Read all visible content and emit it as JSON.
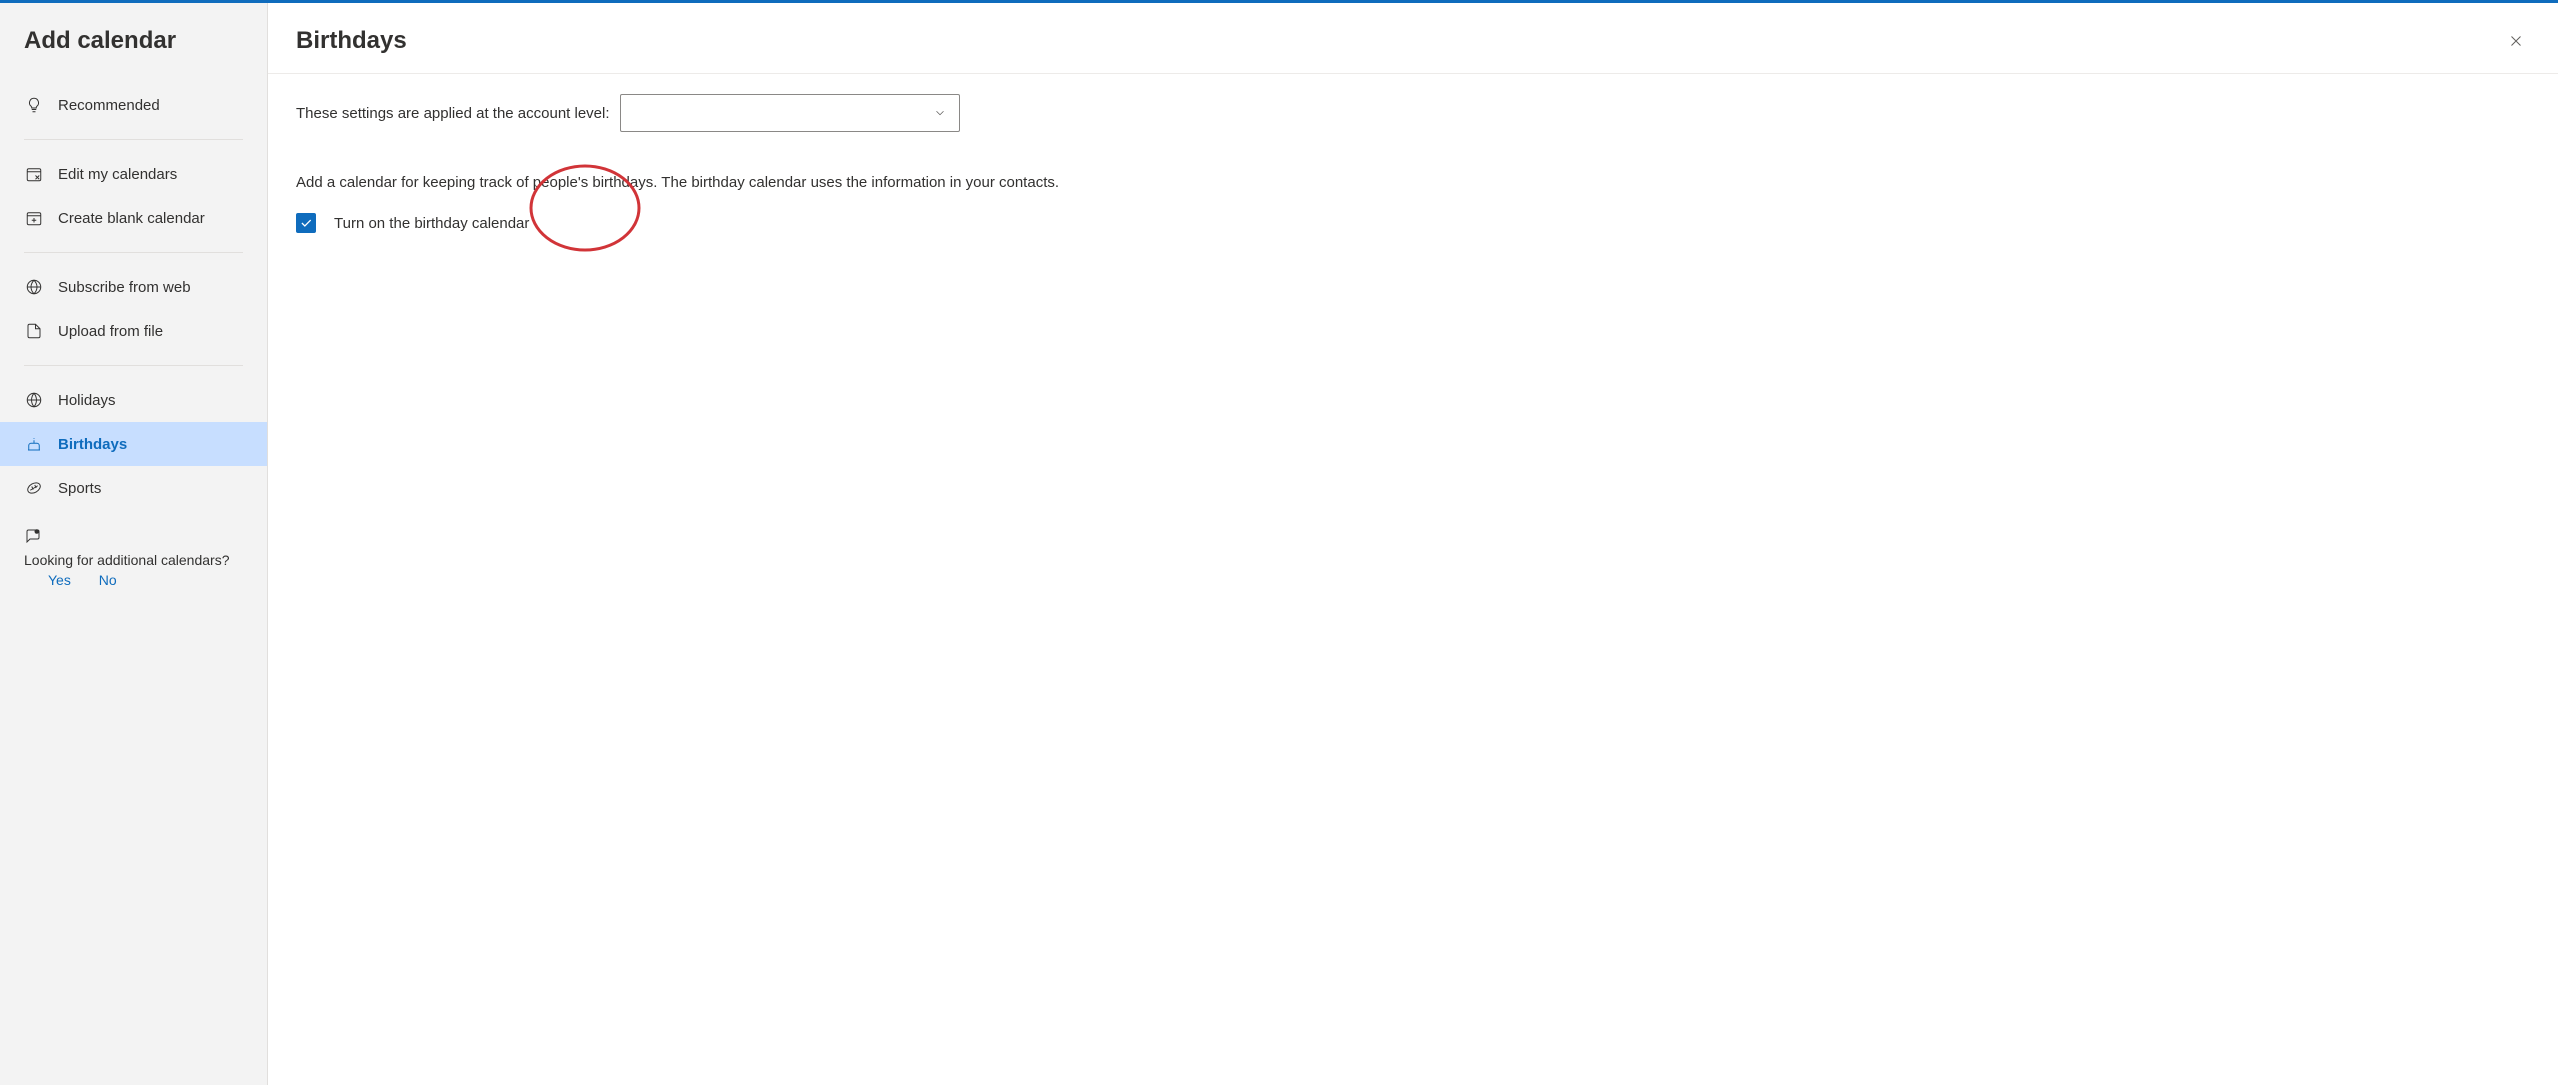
{
  "sidebar": {
    "title": "Add calendar",
    "items": {
      "recommended": "Recommended",
      "editMyCalendars": "Edit my calendars",
      "createBlank": "Create blank calendar",
      "subscribeFromWeb": "Subscribe from web",
      "uploadFromFile": "Upload from file",
      "holidays": "Holidays",
      "birthdays": "Birthdays",
      "sports": "Sports"
    },
    "feedback": {
      "question": "Looking for additional calendars?",
      "yes": "Yes",
      "no": "No"
    }
  },
  "main": {
    "title": "Birthdays",
    "accountLabel": "These settings are applied at the account level:",
    "accountValue": "",
    "description": "Add a calendar for keeping track of people's birthdays. The birthday calendar uses the information in your contacts.",
    "checkboxLabel": "Turn on the birthday calendar",
    "checkboxChecked": true
  },
  "annotation": {
    "color": "#d13438"
  }
}
